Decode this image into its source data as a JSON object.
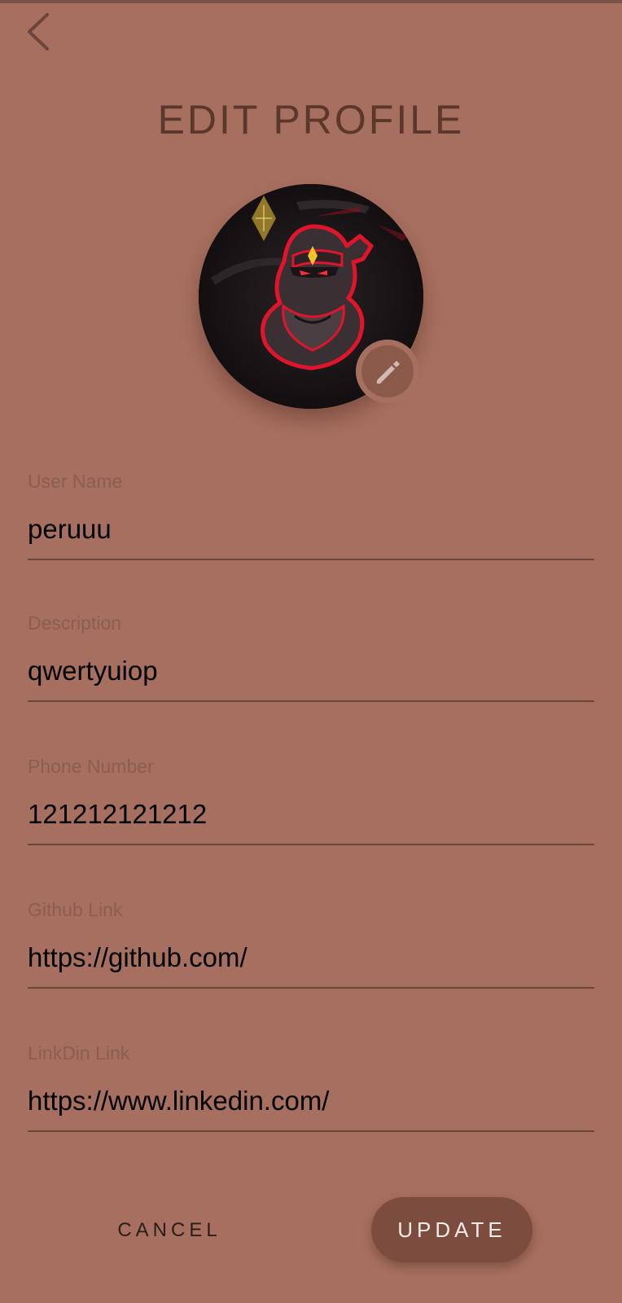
{
  "header": {
    "title": "EDIT PROFILE",
    "back_icon": "chevron-left-icon"
  },
  "avatar": {
    "edit_icon": "pencil-icon"
  },
  "form": {
    "fields": [
      {
        "label": "User Name",
        "value": "peruuu"
      },
      {
        "label": "Description",
        "value": "qwertyuiop"
      },
      {
        "label": "Phone Number",
        "value": "121212121212"
      },
      {
        "label": "Github Link",
        "value": "https://github.com/"
      },
      {
        "label": "LinkDin Link",
        "value": "https://www.linkedin.com/"
      }
    ]
  },
  "actions": {
    "cancel_label": "CANCEL",
    "update_label": "UPDATE"
  },
  "colors": {
    "background": "#a76f5f",
    "title": "#5b372c",
    "label": "#8c5e51",
    "underline": "#6e4539",
    "update_button": "#7c4c3f",
    "edit_badge": "#8c5a4b"
  }
}
